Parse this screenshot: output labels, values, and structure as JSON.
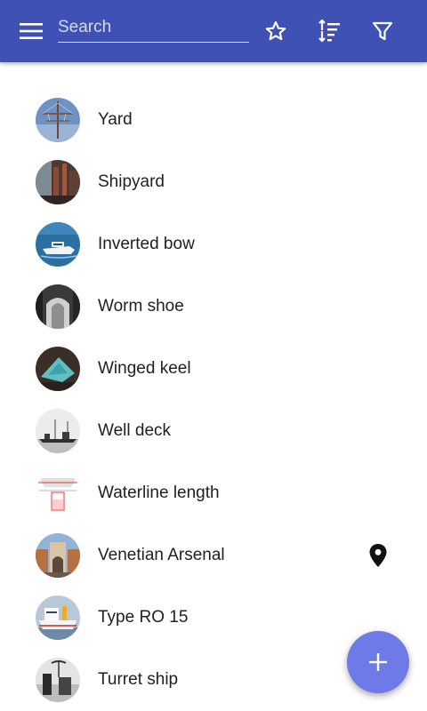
{
  "toolbar": {
    "search_placeholder": "Search",
    "search_value": "",
    "menu_icon": "menu-icon",
    "favorite_icon": "star-outline-icon",
    "sort_icon": "sort-icon",
    "filter_icon": "filter-icon",
    "background_color": "#3f51b5"
  },
  "list": {
    "items": [
      {
        "label": "Yard",
        "thumbnail": "yard-photo"
      },
      {
        "label": "Shipyard",
        "thumbnail": "shipyard-photo"
      },
      {
        "label": "Inverted bow",
        "thumbnail": "inverted-bow-photo"
      },
      {
        "label": "Worm shoe",
        "thumbnail": "worm-shoe-photo"
      },
      {
        "label": "Winged keel",
        "thumbnail": "winged-keel-photo"
      },
      {
        "label": "Well deck",
        "thumbnail": "well-deck-photo"
      },
      {
        "label": "Waterline length",
        "thumbnail": "waterline-length-diagram"
      },
      {
        "label": "Venetian Arsenal",
        "thumbnail": "venetian-arsenal-photo",
        "has_location": true,
        "location_icon": "map-pin-icon"
      },
      {
        "label": "Type RO 15",
        "thumbnail": "type-ro-15-photo"
      },
      {
        "label": "Turret ship",
        "thumbnail": "turret-ship-photo"
      }
    ]
  },
  "fab": {
    "icon": "plus-icon",
    "color": "#6d7ae7"
  }
}
